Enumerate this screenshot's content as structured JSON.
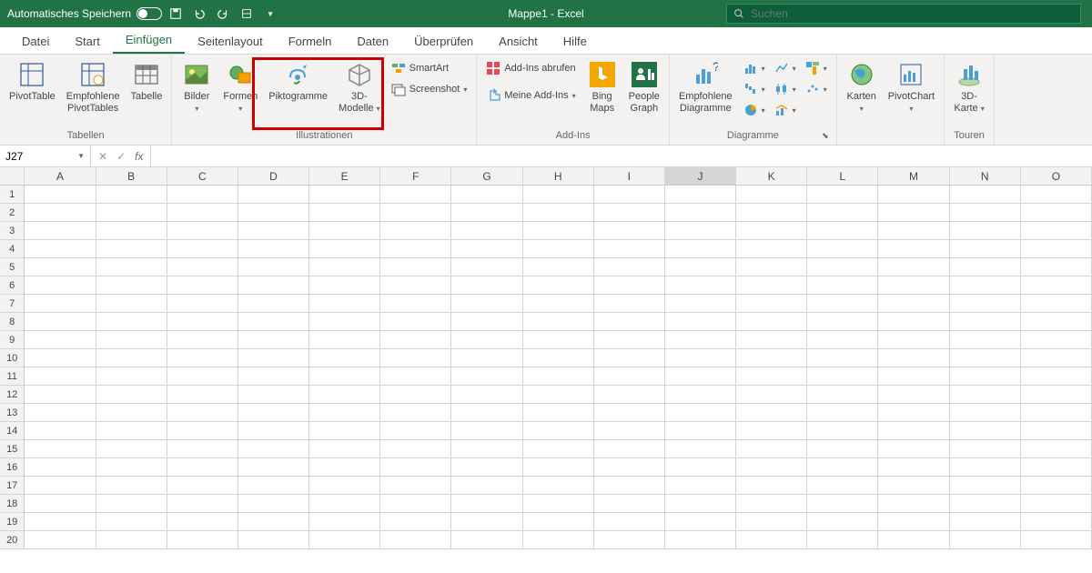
{
  "titlebar": {
    "autosave": "Automatisches Speichern",
    "title": "Mappe1  -  Excel",
    "search_placeholder": "Suchen"
  },
  "tabs": [
    "Datei",
    "Start",
    "Einfügen",
    "Seitenlayout",
    "Formeln",
    "Daten",
    "Überprüfen",
    "Ansicht",
    "Hilfe"
  ],
  "active_tab": 2,
  "ribbon": {
    "groups": {
      "tabellen": {
        "label": "Tabellen",
        "pivottable": "PivotTable",
        "empfohlene_pv": "Empfohlene\nPivotTables",
        "tabelle": "Tabelle"
      },
      "illustrationen": {
        "label": "Illustrationen",
        "bilder": "Bilder",
        "formen": "Formen",
        "piktogramme": "Piktogramme",
        "modelle": "3D-\nModelle",
        "smartart": "SmartArt",
        "screenshot": "Screenshot"
      },
      "addins": {
        "label": "Add-Ins",
        "abrufen": "Add-Ins abrufen",
        "meine": "Meine Add-Ins",
        "bingmaps": "Bing\nMaps",
        "peoplegraph": "People\nGraph"
      },
      "diagramme": {
        "label": "Diagramme",
        "empfohlene": "Empfohlene\nDiagramme"
      },
      "karten": {
        "karten": "Karten"
      },
      "pivotchart": {
        "pivotchart": "PivotChart"
      },
      "touren": {
        "label": "Touren",
        "karte3d": "3D-\nKarte"
      }
    }
  },
  "formulabar": {
    "namebox": "J27"
  },
  "columns": [
    "A",
    "B",
    "C",
    "D",
    "E",
    "F",
    "G",
    "H",
    "I",
    "J",
    "K",
    "L",
    "M",
    "N",
    "O"
  ],
  "selected_col": "J",
  "rows": 20
}
